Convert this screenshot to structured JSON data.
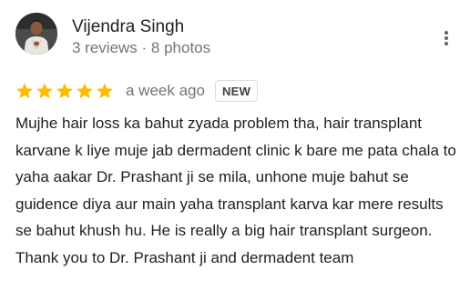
{
  "reviewer": {
    "name": "Vijendra Singh",
    "meta": "3 reviews · 8 photos",
    "avatar_icon": "user-avatar-photo"
  },
  "rating": {
    "stars": 5,
    "max_stars": 5,
    "star_color": "#fbbc04",
    "time": "a week ago",
    "badge": "NEW"
  },
  "review": {
    "text": "Mujhe hair loss ka bahut zyada problem tha, hair transplant karvane k liye muje jab dermadent clinic k bare me pata chala to yaha aakar Dr. Prashant ji se mila, unhone muje bahut se guidence diya aur main yaha transplant karva kar mere results se bahut khush hu. He is really a big hair transplant surgeon. Thank you to Dr. Prashant ji and dermadent team"
  },
  "icons": {
    "more": "more-vert-icon",
    "star": "star-icon"
  }
}
